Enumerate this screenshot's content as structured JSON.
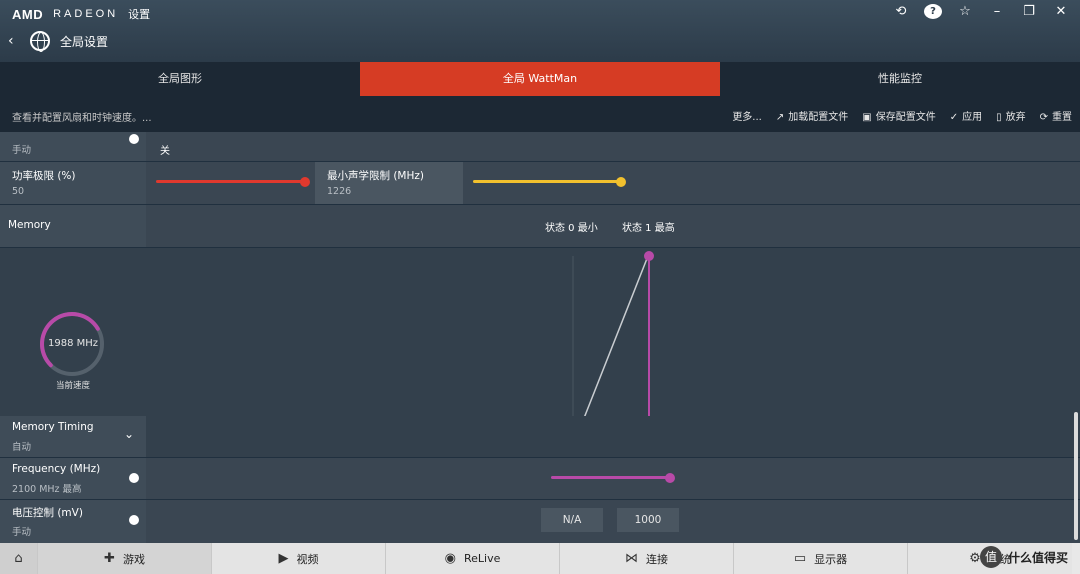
{
  "window": {
    "brand_amd": "AMD",
    "brand_radeon": "RADEON",
    "brand_settings": "设置",
    "page_title": "全局设置"
  },
  "tabs": [
    {
      "label": "全局图形",
      "active": false
    },
    {
      "label": "全局 WattMan",
      "active": true
    },
    {
      "label": "性能监控",
      "active": false
    }
  ],
  "toolbar": {
    "description": "查看并配置风扇和时钟速度。...",
    "more": "更多...",
    "load_profile": "加载配置文件",
    "save_profile": "保存配置文件",
    "apply": "应用",
    "discard": "放弃",
    "reset": "重置"
  },
  "top_partial": {
    "left_value": "手动",
    "right_value": "关"
  },
  "power": {
    "label": "功率极限 (%)",
    "value": "50",
    "slider_fraction": 0.35
  },
  "acoustic": {
    "label": "最小声学限制 (MHz)",
    "value": "1226",
    "slider_fraction": 0.5
  },
  "memory": {
    "label": "Memory",
    "state0": "状态 0 最小",
    "state1": "状态 1 最高",
    "gauge_value": "1988 MHz",
    "gauge_label": "当前速度",
    "gauge_fraction": 0.72
  },
  "memory_timing": {
    "label": "Memory Timing",
    "value": "自动"
  },
  "frequency": {
    "label": "Frequency (MHz)",
    "value": "2100 MHz 最高"
  },
  "voltage": {
    "label": "电压控制 (mV)",
    "value": "手动",
    "box1": "N/A",
    "box2": "1000"
  },
  "bottom_nav": {
    "games": "游戏",
    "video": "视频",
    "relive": "ReLive",
    "connect": "连接",
    "display": "显示器",
    "system": "系统"
  },
  "watermark": {
    "badge": "值",
    "text": "什么值得买"
  },
  "colors": {
    "accent_red": "#d63c24",
    "slider_red": "#e0392e",
    "slider_yellow": "#f2c12e",
    "memory_magenta": "#b84aa8"
  }
}
